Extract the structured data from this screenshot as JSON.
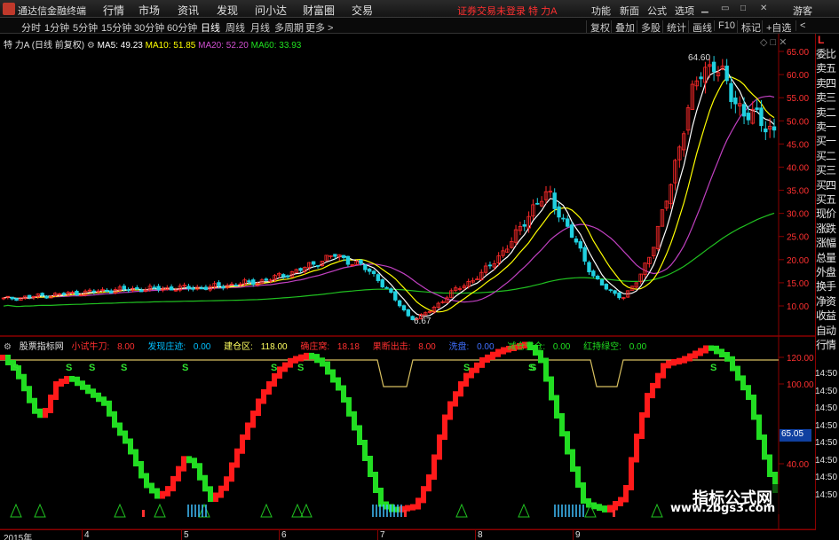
{
  "menubar": {
    "app_title": "通达信金融终端",
    "items": [
      "行情",
      "市场",
      "资讯",
      "发现",
      "问小达",
      "财富圈",
      "交易"
    ],
    "login_status": "证券交易未登录 特 力A",
    "right_items": [
      "功能",
      "新面",
      "公式",
      "选项",
      "游客"
    ]
  },
  "periodbar": {
    "items": [
      "分时",
      "1分钟",
      "5分钟",
      "15分钟",
      "30分钟",
      "60分钟",
      "日线",
      "周线",
      "月线",
      "多周期",
      "更多 >"
    ],
    "active": "日线",
    "right_items": [
      "复权",
      "叠加",
      "多股",
      "统计",
      "画线",
      "F10",
      "标记",
      "+自选",
      "<"
    ]
  },
  "legend": {
    "stock": "特 力A",
    "adj": "(日线 前复权)",
    "ma5": "MA5: 49.23",
    "ma10": "MA10: 51.85",
    "ma20": "MA20: 52.20",
    "ma60": "MA60: 33.93",
    "high_label": "64.60",
    "low_label": "6.67"
  },
  "price_axis": [
    "65.00",
    "60.00",
    "55.00",
    "50.00",
    "45.00",
    "40.00",
    "35.00",
    "30.00",
    "25.00",
    "20.00",
    "15.00",
    "10.00"
  ],
  "indicator": {
    "name": "股票指标网",
    "items": [
      {
        "label": "小试牛刀:",
        "value": "8.00",
        "color": "#ff3030"
      },
      {
        "label": "发现庄迹:",
        "value": "0.00",
        "color": "#00c0ff"
      },
      {
        "label": "建仓区:",
        "value": "118.00",
        "color": "#ffff60"
      },
      {
        "label": "确庄窝:",
        "value": "18.18",
        "color": "#ff3030"
      },
      {
        "label": "果断出击:",
        "value": "8.00",
        "color": "#ff3030"
      },
      {
        "label": "洗盘:",
        "value": "0.00",
        "color": "#4070ff"
      },
      {
        "label": "减仓空仓:",
        "value": "0.00",
        "color": "#00ff00"
      },
      {
        "label": "红持绿空:",
        "value": "0.00",
        "color": "#00ff00"
      }
    ],
    "axis": [
      "120.00",
      "100.00",
      "65.05",
      "40.00"
    ],
    "badge": "65.05"
  },
  "right_panel": {
    "top_label": "L",
    "items": [
      "委比",
      "卖五",
      "卖四",
      "卖三",
      "卖二",
      "卖一",
      "买一",
      "买二",
      "买三",
      "买四",
      "买五",
      "现价",
      "涨跌",
      "涨幅",
      "总量",
      "外盘",
      "换手",
      "净资",
      "收益",
      "自动",
      "行情"
    ],
    "times": [
      "14:50",
      "14:50",
      "14:50",
      "14:50",
      "14:50",
      "14:50",
      "14:50",
      "14:50"
    ]
  },
  "time_axis": [
    "2015年",
    "4",
    "5",
    "6",
    "7",
    "8",
    "9"
  ],
  "watermark": {
    "line1": "指标公式网",
    "line2": "www.zbgs3.com"
  },
  "colors": {
    "up": "#ff2a2a",
    "down": "#20d0e0",
    "ma5": "#ffffff",
    "ma10": "#ffff00",
    "ma20": "#c040c0",
    "ma60": "#20c020",
    "ind_red": "#ff1a1a",
    "ind_green": "#22dd22",
    "frame": "#8b0000"
  }
}
